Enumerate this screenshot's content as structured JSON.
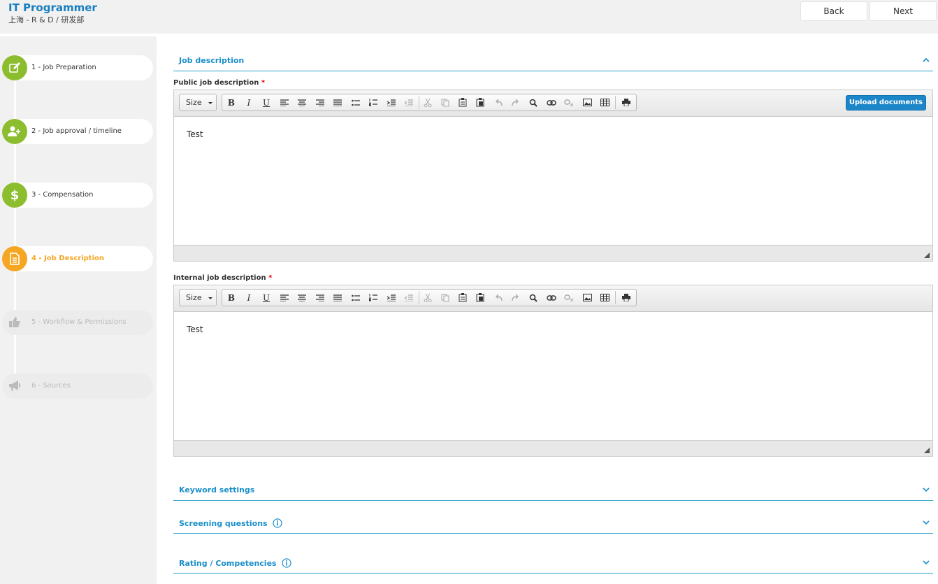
{
  "header": {
    "title": "IT Programmer",
    "subtitle": "上海 - R & D / 研发部",
    "back_label": "Back",
    "next_label": "Next"
  },
  "sidebar": {
    "steps": [
      {
        "label": "1 - Job Preparation",
        "icon": "edit-icon",
        "state": "done"
      },
      {
        "label": "2 - Job approval / timeline",
        "icon": "user-plus-icon",
        "state": "done"
      },
      {
        "label": "3 - Compensation",
        "icon": "dollar-icon",
        "state": "done"
      },
      {
        "label": "4 - Job Description",
        "icon": "document-icon",
        "state": "active"
      },
      {
        "label": "5 - Workflow & Permissions",
        "icon": "thumbs-up-icon",
        "state": "disabled"
      },
      {
        "label": "6 - Sources",
        "icon": "megaphone-icon",
        "state": "disabled"
      }
    ]
  },
  "main": {
    "job_description": {
      "title": "Job description",
      "public_label": "Public job description",
      "internal_label": "Internal job description",
      "required_mark": "*",
      "size_label": "Size",
      "upload_label": "Upload documents",
      "public_content": "Test",
      "internal_content": "Test"
    },
    "sections": {
      "keyword": "Keyword settings",
      "screening": "Screening questions",
      "rating": "Rating / Competencies"
    }
  },
  "colors": {
    "accent_blue": "#1a8fc9",
    "step_green": "#8cbd2e",
    "step_orange": "#f5a623",
    "upload_blue": "#1d86c9"
  }
}
